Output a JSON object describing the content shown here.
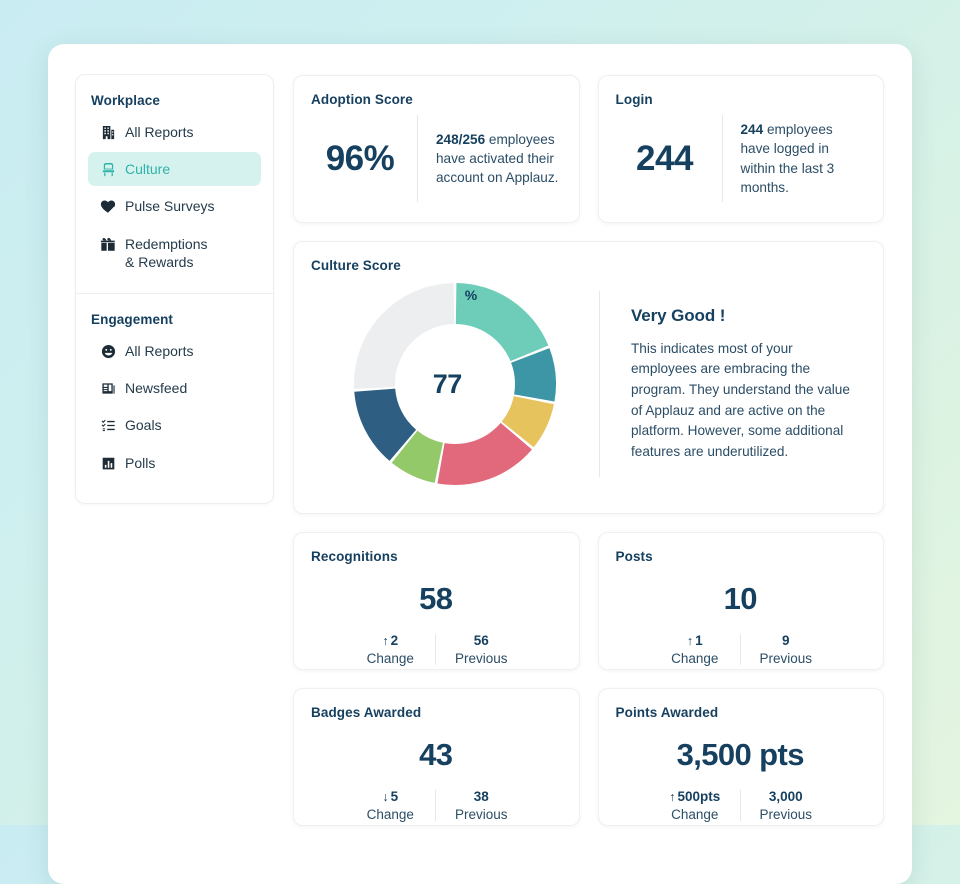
{
  "sidebar": {
    "groups": [
      {
        "title": "Workplace",
        "items": [
          {
            "label": "All Reports",
            "icon": "building-icon",
            "active": false
          },
          {
            "label": "Culture",
            "icon": "culture-icon",
            "active": true
          },
          {
            "label": "Pulse Surveys",
            "icon": "heartbeat-icon",
            "active": false
          },
          {
            "label": "Redemptions",
            "label2": "& Rewards",
            "icon": "gift-icon",
            "active": false
          }
        ]
      },
      {
        "title": "Engagement",
        "items": [
          {
            "label": "All Reports",
            "icon": "smiley-icon",
            "active": false
          },
          {
            "label": "Newsfeed",
            "icon": "newspaper-icon",
            "active": false
          },
          {
            "label": "Goals",
            "icon": "checklist-icon",
            "active": false
          },
          {
            "label": "Polls",
            "icon": "bar-chart-icon",
            "active": false
          }
        ]
      }
    ]
  },
  "adoption": {
    "title": "Adoption Score",
    "value": "96%",
    "text_bold": "248/256",
    "text_rest": " employees have activated their account on Applauz."
  },
  "login": {
    "title": "Login",
    "value": "244",
    "text_bold": "244",
    "text_rest": " employees have logged in within the last 3 months."
  },
  "culture": {
    "title": "Culture Score",
    "score": "77",
    "score_unit": "%",
    "heading": "Very Good !",
    "description": "This indicates most of your employees are embracing the program. They understand the value of Applauz and are active on the platform. However, some additional features are underutilized."
  },
  "chart_data": {
    "type": "pie",
    "title": "Culture Score",
    "center_label": "77%",
    "total": 100,
    "legend": "none",
    "segments": [
      {
        "name": "mint",
        "value": 19,
        "color": "#6ecdb8"
      },
      {
        "name": "teal",
        "value": 9,
        "color": "#3c96a6"
      },
      {
        "name": "yellow",
        "value": 8,
        "color": "#e6c35c"
      },
      {
        "name": "red",
        "value": 17,
        "color": "#e2697c"
      },
      {
        "name": "green",
        "value": 8,
        "color": "#94c96a"
      },
      {
        "name": "navy",
        "value": 13,
        "color": "#2e5f82"
      },
      {
        "name": "empty-track",
        "value": 26,
        "color": "#eceeef"
      }
    ]
  },
  "metrics": [
    {
      "title": "Recognitions",
      "value": "58",
      "change": "2",
      "change_dir": "up",
      "change_label": "Change",
      "previous": "56",
      "previous_label": "Previous"
    },
    {
      "title": "Posts",
      "value": "10",
      "change": "1",
      "change_dir": "up",
      "change_label": "Change",
      "previous": "9",
      "previous_label": "Previous"
    },
    {
      "title": "Badges Awarded",
      "value": "43",
      "change": "5",
      "change_dir": "down",
      "change_label": "Change",
      "previous": "38",
      "previous_label": "Previous"
    },
    {
      "title": "Points Awarded",
      "value": "3,500 pts",
      "change": "500pts",
      "change_dir": "up",
      "change_label": "Change",
      "previous": "3,000",
      "previous_label": "Previous"
    }
  ]
}
